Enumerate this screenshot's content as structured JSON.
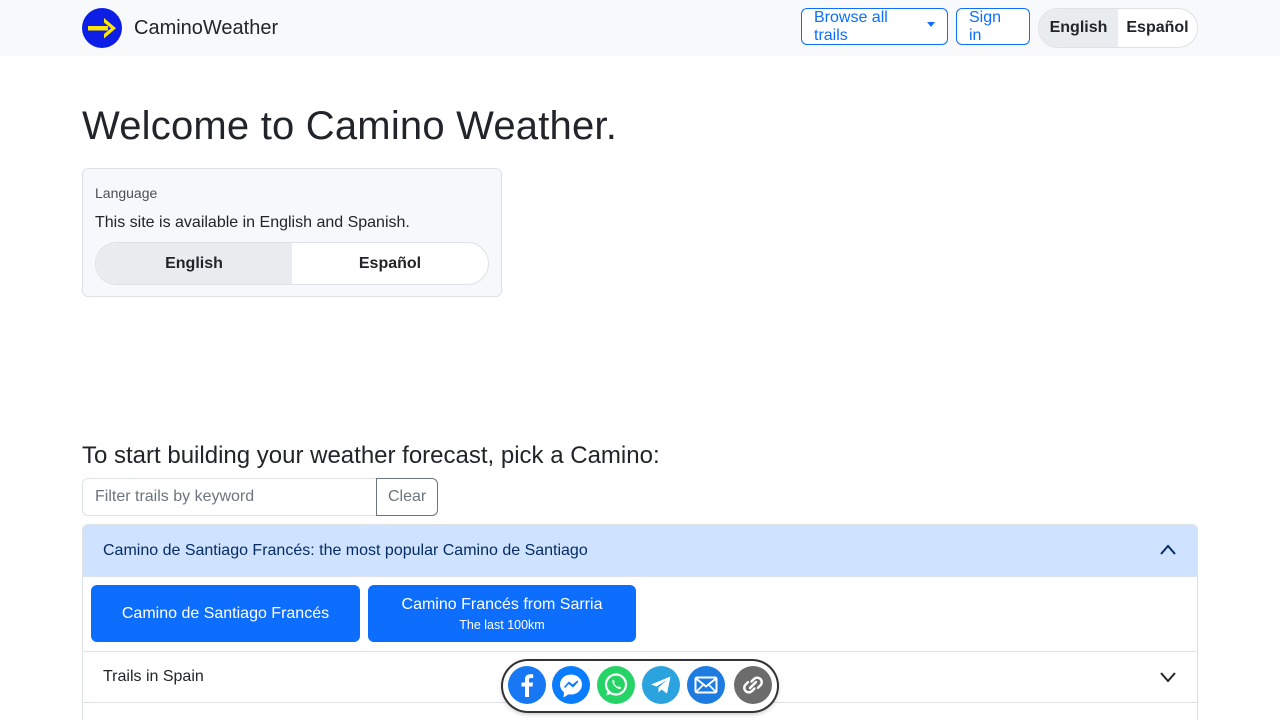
{
  "navbar": {
    "brand": "CaminoWeather",
    "browse_label": "Browse all trails",
    "signin_label": "Sign in",
    "languages": [
      "English",
      "Español"
    ]
  },
  "main": {
    "title": "Welcome to Camino Weather.",
    "language_card": {
      "caption": "Language",
      "description": "This site is available in English and Spanish.",
      "options": [
        "English",
        "Español"
      ]
    },
    "pick_heading": "To start building your weather forecast, pick a Camino:",
    "filter": {
      "placeholder": "Filter trails by keyword",
      "clear_label": "Clear"
    },
    "accordion": {
      "sections": [
        {
          "title": "Camino de Santiago Francés: the most popular Camino de Santiago",
          "expanded": true,
          "trails": [
            {
              "name": "Camino de Santiago Francés",
              "subtitle": ""
            },
            {
              "name": "Camino Francés from Sarria",
              "subtitle": "The last 100km"
            }
          ]
        },
        {
          "title": "Trails in Spain",
          "expanded": false
        }
      ]
    }
  },
  "share_bar": {
    "icons": [
      "facebook-icon",
      "messenger-icon",
      "whatsapp-icon",
      "telegram-icon",
      "email-icon",
      "link-icon"
    ]
  },
  "colors": {
    "primary": "#0d6efd",
    "accordion_open_bg": "#cfe2ff",
    "logo_bg": "#0d1ee6",
    "logo_arrow": "#ffe600"
  }
}
